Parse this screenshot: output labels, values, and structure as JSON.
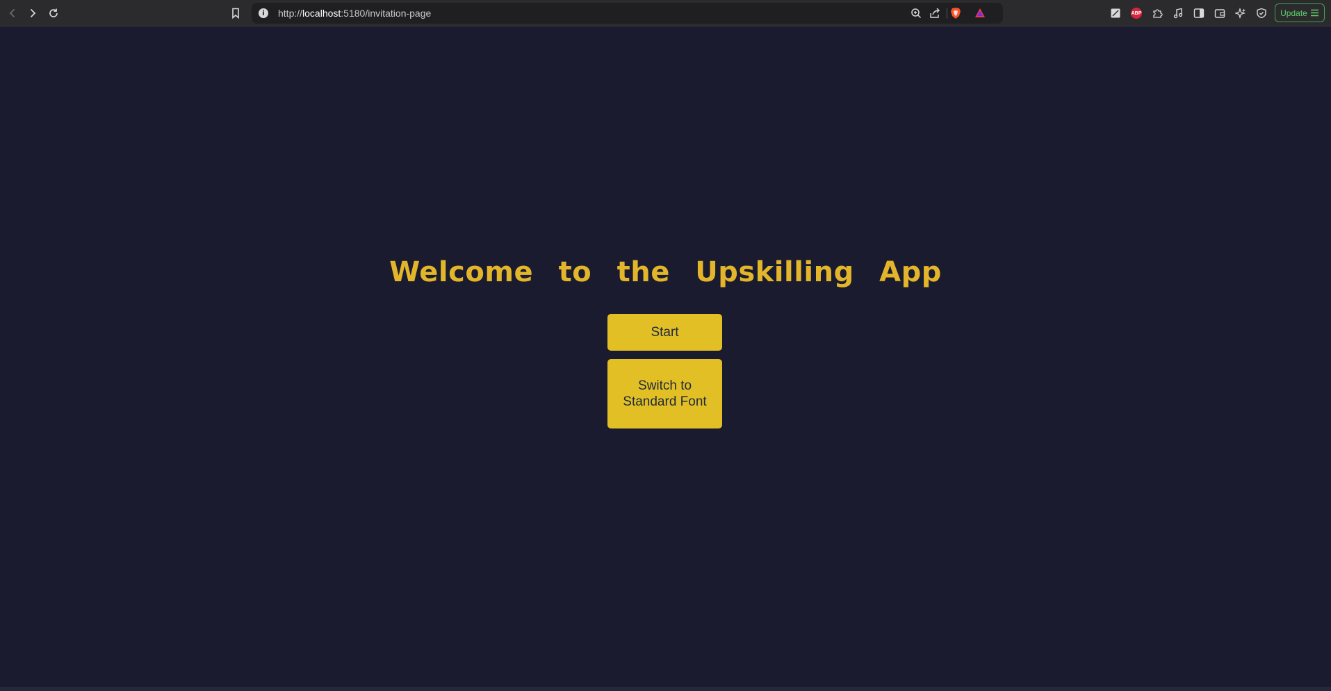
{
  "browser": {
    "url_scheme": "http://",
    "url_host": "localhost",
    "url_path": ":5180/invitation-page",
    "update_label": "Update",
    "icons": {
      "back": "back-arrow-icon",
      "forward": "forward-arrow-icon",
      "reload": "reload-icon",
      "bookmark": "bookmark-icon",
      "info": "site-info-icon",
      "zoom": "zoom-icon",
      "share": "share-icon",
      "brave_shields": "brave-shields-icon",
      "brave_rewards": "brave-rewards-icon",
      "extensions": [
        "extension-icon",
        "adblock-plus-icon",
        "puzzle-extensions-icon",
        "media-icon",
        "sidebar-icon",
        "wallet-icon",
        "ai-assistant-icon",
        "vpn-shield-icon"
      ],
      "menu": "hamburger-menu-icon"
    }
  },
  "page": {
    "title": "Welcome to the Upskilling App",
    "start_label": "Start",
    "switch_font_label": "Switch to Standard Font"
  },
  "colors": {
    "background": "#1b1b2f",
    "accent": "#e2b52a",
    "button": "#e2bf25",
    "button_text": "#1e2a3a",
    "update_green": "#5fcf6a"
  }
}
